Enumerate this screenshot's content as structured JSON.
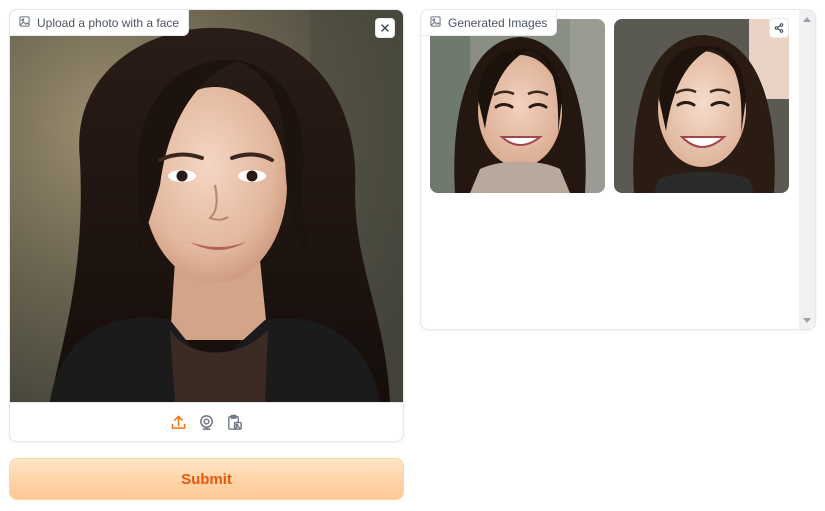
{
  "input": {
    "label": "Upload a photo with a face",
    "image_icon": "image-icon",
    "clear_icon": "close-icon",
    "sources": [
      {
        "name": "upload-icon",
        "color": "#f97316"
      },
      {
        "name": "webcam-icon",
        "color": "#6b7280"
      },
      {
        "name": "clipboard-icon",
        "color": "#6b7280"
      }
    ]
  },
  "submit": {
    "label": "Submit",
    "text_color": "#ea580c"
  },
  "output": {
    "label": "Generated Images",
    "image_icon": "image-icon",
    "share_icon": "share-icon",
    "images": [
      {
        "name": "generated-image-1"
      },
      {
        "name": "generated-image-2"
      }
    ]
  },
  "theme": {
    "accent": "#f97316",
    "border": "#e5e7eb"
  }
}
